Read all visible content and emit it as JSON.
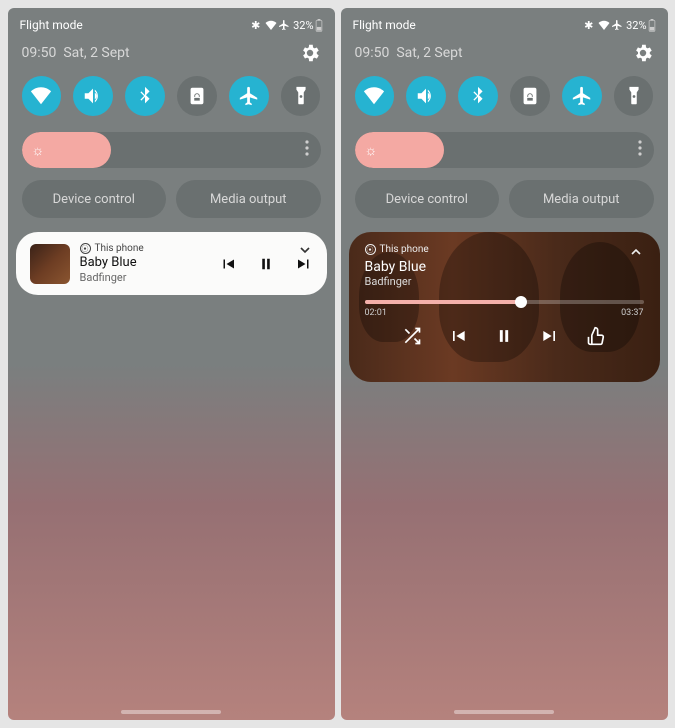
{
  "status": {
    "mode_label": "Flight mode",
    "battery_text": "32%",
    "icons": [
      "bluetooth",
      "wifi",
      "airplane"
    ]
  },
  "header": {
    "time": "09:50",
    "date": "Sat, 2 Sept"
  },
  "quick_settings": [
    {
      "name": "wifi",
      "on": true
    },
    {
      "name": "volume",
      "on": true
    },
    {
      "name": "bluetooth",
      "on": true
    },
    {
      "name": "rotation-lock",
      "on": false
    },
    {
      "name": "airplane",
      "on": true
    },
    {
      "name": "flashlight",
      "on": false
    }
  ],
  "brightness": {
    "percent": 30
  },
  "buttons": {
    "device_control": "Device control",
    "media_output": "Media output"
  },
  "media": {
    "source_label": "This phone",
    "title": "Baby Blue",
    "artist": "Badfinger",
    "progress_percent": 56,
    "elapsed": "02:01",
    "total": "03:37"
  }
}
